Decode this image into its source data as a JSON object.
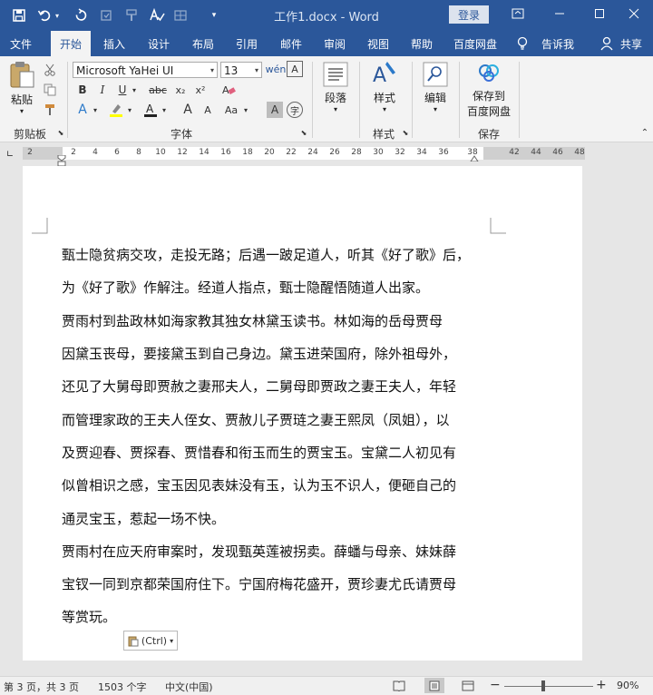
{
  "title_bar": {
    "doc_title": "工作1.docx  -  Word",
    "login_label": "登录",
    "quick_access": [
      "save-icon",
      "undo-icon",
      "undo-dropdown-icon",
      "redo-icon",
      "touch-mode-icon",
      "format-painter-icon",
      "spelling-icon",
      "customize-dropdown-icon"
    ]
  },
  "tabs": [
    {
      "label": "文件"
    },
    {
      "label": "开始"
    },
    {
      "label": "插入"
    },
    {
      "label": "设计"
    },
    {
      "label": "布局"
    },
    {
      "label": "引用"
    },
    {
      "label": "邮件"
    },
    {
      "label": "审阅"
    },
    {
      "label": "视图"
    },
    {
      "label": "帮助"
    },
    {
      "label": "百度网盘"
    },
    {
      "label": "告诉我"
    },
    {
      "label": "共享"
    }
  ],
  "ribbon": {
    "clipboard": {
      "paste_label": "粘贴",
      "group_label": "剪贴板"
    },
    "font": {
      "font_name": "Microsoft YaHei UI",
      "font_size": "13",
      "group_label": "字体",
      "bold": "B",
      "italic": "I",
      "underline": "U",
      "strike": "abc",
      "subscript": "x₂",
      "superscript": "x²",
      "grow": "A",
      "shrink": "A",
      "change_case": "Aa",
      "char_shade": "A",
      "enclose": "字"
    },
    "paragraph": {
      "label": "段落"
    },
    "styles": {
      "label": "样式",
      "group_label": "样式"
    },
    "editing": {
      "label": "编辑"
    },
    "baidu": {
      "label_line1": "保存到",
      "label_line2": "百度网盘",
      "group_label": "保存"
    }
  },
  "ruler": {
    "ticks": [
      "2",
      "2",
      "4",
      "6",
      "8",
      "10",
      "12",
      "14",
      "16",
      "18",
      "20",
      "22",
      "24",
      "26",
      "28",
      "30",
      "32",
      "34",
      "36",
      "38",
      "42",
      "44",
      "46",
      "48"
    ]
  },
  "document": {
    "lines": [
      "甄士隐贫病交攻，走投无路；后遇一跛足道人，听其《好了歌》后，",
      "为《好了歌》作解注。经道人指点，甄士隐醒悟随道人出家。",
      "贾雨村到盐政林如海家教其独女林黛玉读书。林如海的岳母贾母",
      "因黛玉丧母，要接黛玉到自己身边。黛玉进荣国府，除外祖母外，",
      "还见了大舅母即贾赦之妻邢夫人，二舅母即贾政之妻王夫人，年轻",
      "而管理家政的王夫人侄女、贾赦儿子贾琏之妻王熙凤（凤姐），以",
      "及贾迎春、贾探春、贾惜春和衔玉而生的贾宝玉。宝黛二人初见有",
      "似曾相识之感，宝玉因见表妹没有玉，认为玉不识人，便砸自己的",
      "通灵宝玉，惹起一场不快。",
      "贾雨村在应天府审案时，发现甄英莲被拐卖。薛蟠与母亲、妹妹薛",
      "宝钗一同到京都荣国府住下。宁国府梅花盛开，贾珍妻尤氏请贾母",
      "等赏玩。"
    ],
    "paste_options_label": "(Ctrl)"
  },
  "status_bar": {
    "page": "第 3 页，共 3 页",
    "words": "1503 个字",
    "language": "中文(中国)",
    "zoom": "90%",
    "minus": "−",
    "plus": "+"
  }
}
